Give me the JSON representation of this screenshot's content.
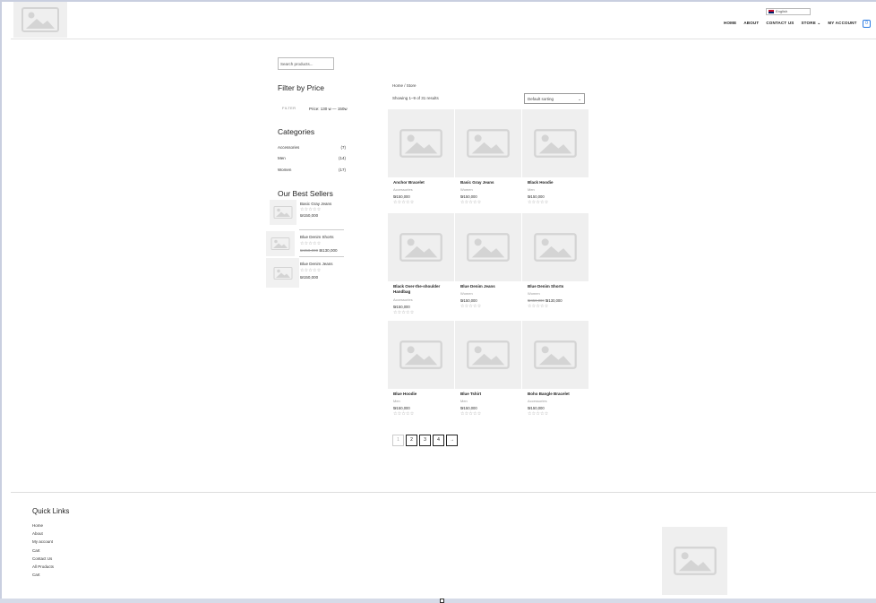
{
  "header": {
    "language": "English",
    "nav": [
      "HOME",
      "ABOUT",
      "CONTACT US",
      "STORE ⌄",
      "MY ACCOUNT"
    ],
    "cart_count": "0"
  },
  "sidebar": {
    "search_placeholder": "Search products...",
    "filter_title": "Filter by Price",
    "filter_button": "FILTER",
    "price_range": "Price: 130 ש150 — ש",
    "categories_title": "Categories",
    "categories": [
      {
        "name": "Accessories",
        "count": "(7)"
      },
      {
        "name": "Men",
        "count": "(14)"
      },
      {
        "name": "Women",
        "count": "(17)"
      }
    ],
    "best_sellers_title": "Our Best Sellers",
    "best_sellers": [
      {
        "name": "Basic Gray Jeans",
        "stars": "☆☆☆☆☆",
        "old_price": "",
        "price": "₪150,000"
      },
      {
        "name": "Blue Denim Shorts",
        "stars": "☆☆☆☆☆",
        "old_price": "₪450,000",
        "price": "₪130,000"
      },
      {
        "name": "Blue Denim Jeans",
        "stars": "☆☆☆☆☆",
        "old_price": "",
        "price": "₪150,000"
      }
    ]
  },
  "main": {
    "breadcrumb": "Home / Store",
    "result_count": "Showing 1–9 of 31 results",
    "sort_label": "Default sorting",
    "products": [
      {
        "title": "Anchor Bracelet",
        "category": "Accessories",
        "old_price": "",
        "price": "₪150,000",
        "stars": "☆☆☆☆☆"
      },
      {
        "title": "Basic Gray Jeans",
        "category": "Women",
        "old_price": "",
        "price": "₪150,000",
        "stars": "☆☆☆☆☆"
      },
      {
        "title": "Black Hoodie",
        "category": "Men",
        "old_price": "",
        "price": "₪150,000",
        "stars": "☆☆☆☆☆"
      },
      {
        "title": "Black Over-the-shoulder Handbag",
        "category": "Accessories",
        "old_price": "",
        "price": "₪150,000",
        "stars": "☆☆☆☆☆"
      },
      {
        "title": "Blue Denim Jeans",
        "category": "Women",
        "old_price": "",
        "price": "₪150,000",
        "stars": "☆☆☆☆☆"
      },
      {
        "title": "Blue Denim Shorts",
        "category": "Women",
        "old_price": "₪450,000",
        "price": "₪130,000",
        "stars": "☆☆☆☆☆"
      },
      {
        "title": "Blue Hoodie",
        "category": "Men",
        "old_price": "",
        "price": "₪150,000",
        "stars": "☆☆☆☆☆"
      },
      {
        "title": "Blue Tshirt",
        "category": "Men",
        "old_price": "",
        "price": "₪150,000",
        "stars": "☆☆☆☆☆"
      },
      {
        "title": "Boho Bangle Bracelet",
        "category": "Accessories",
        "old_price": "",
        "price": "₪150,000",
        "stars": "☆☆☆☆☆"
      }
    ],
    "pagination": [
      "1",
      "2",
      "3",
      "4",
      "→"
    ]
  },
  "footer": {
    "quick_links_title": "Quick Links",
    "links": [
      "Home",
      "About",
      "My account",
      "Cart",
      "Contact Us",
      "All Products",
      "Cart"
    ]
  },
  "colors": {
    "accent": "#2a7ae2",
    "placeholder_bg": "#efefef",
    "placeholder_icon": "#d4d4d4"
  }
}
